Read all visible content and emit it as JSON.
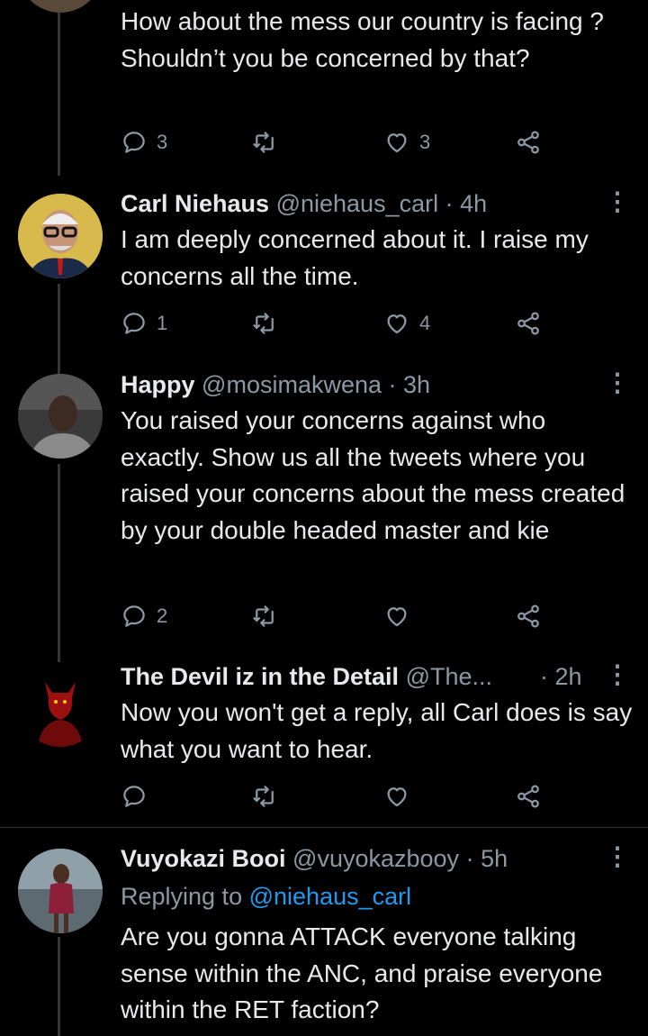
{
  "tweets": [
    {
      "text": "How about the mess our country is facing ? Shouldn’t you be concerned by that?",
      "replies": "3",
      "likes": "3"
    },
    {
      "name": "Carl Niehaus",
      "handle": "@niehaus_carl",
      "time": "· 4h",
      "text": "I am deeply concerned about it. I raise my concerns all the time.",
      "replies": "1",
      "likes": "4"
    },
    {
      "name": "Happy",
      "handle": "@mosimakwena",
      "time": "· 3h",
      "text": "You raised your concerns against who exactly. Show us all the tweets where you raised your concerns about the mess created by your double headed master and kie",
      "replies": "2",
      "likes": ""
    },
    {
      "name": "The Devil iz in the Detail",
      "handle": "@The...",
      "time": "· 2h",
      "text": "Now you won't get a reply, all Carl does is say what you want to hear.",
      "replies": "",
      "likes": ""
    },
    {
      "name": "Vuyokazi Booi",
      "handle": "@vuyokazbooy",
      "time": "· 5h",
      "replying_prefix": "Replying to",
      "replying_user": "@niehaus_carl",
      "text": "Are you gonna ATTACK everyone talking sense within the ANC, and praise everyone within the RET faction?"
    }
  ],
  "more_glyph": "⋮",
  "colors": {
    "background": "#000000",
    "text": "#e7e9ea",
    "muted": "#8b98a5",
    "link": "#1d9bf0"
  },
  "icons": {
    "reply": "reply-icon",
    "retweet": "retweet-icon",
    "like": "like-icon",
    "share": "share-icon",
    "more": "more-icon"
  }
}
